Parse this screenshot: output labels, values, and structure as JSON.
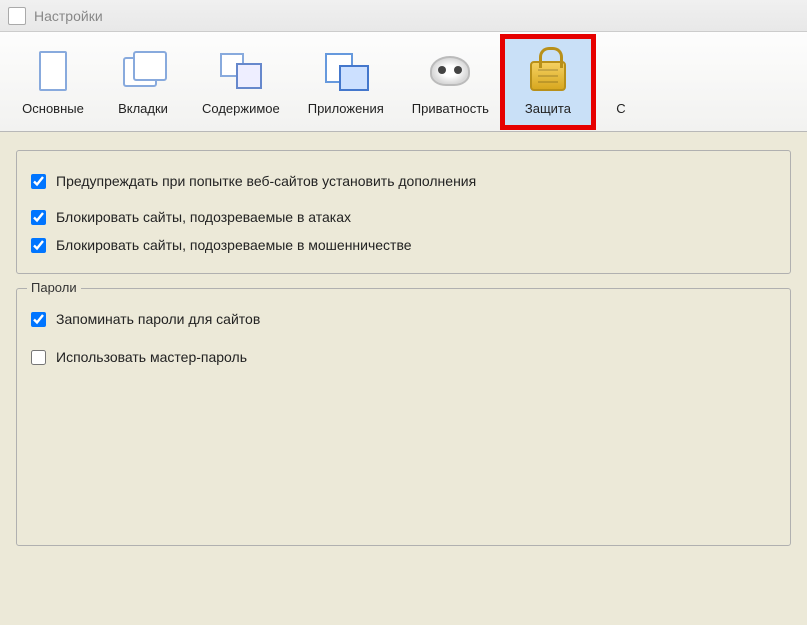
{
  "window": {
    "title": "Настройки"
  },
  "toolbar": {
    "items": [
      {
        "label": "Основные"
      },
      {
        "label": "Вкладки"
      },
      {
        "label": "Содержимое"
      },
      {
        "label": "Приложения"
      },
      {
        "label": "Приватность"
      },
      {
        "label": "Защита"
      },
      {
        "label": "С"
      }
    ]
  },
  "security": {
    "warnAddons": "Предупреждать при попытке веб-сайтов установить дополнения",
    "blockAttack": "Блокировать сайты, подозреваемые в атаках",
    "blockFraud": "Блокировать сайты, подозреваемые в мошенничестве"
  },
  "passwords": {
    "groupTitle": "Пароли",
    "remember": "Запоминать пароли для сайтов",
    "useMaster": "Использовать мастер-пароль"
  }
}
